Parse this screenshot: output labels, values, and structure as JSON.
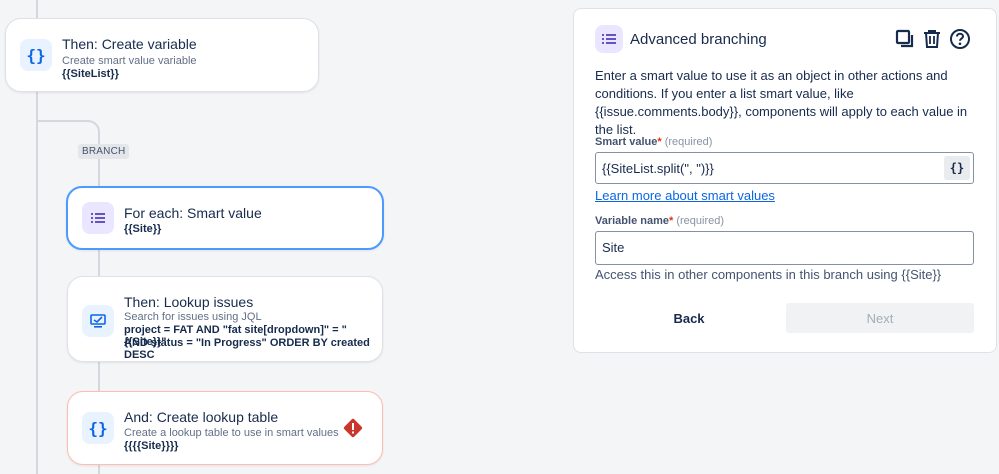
{
  "canvas": {
    "cards": [
      {
        "title": "Then: Create variable",
        "desc": "Create smart value variable",
        "bold": "{{SiteList}}",
        "icon": "braces-icon"
      },
      {
        "title": "For each: Smart value",
        "bold": "{{Site}}",
        "icon": "list-icon"
      },
      {
        "title": "Then: Lookup issues",
        "desc": "Search for issues using JQL",
        "bold_lines": [
          "project = FAT AND \"fat site[dropdown]\" = \"{{Site}}\"",
          "AND status = \"In Progress\" ORDER BY created DESC"
        ],
        "icon": "monitor-icon"
      },
      {
        "title": "And: Create lookup table",
        "desc": "Create a lookup table to use in smart values",
        "bold": "{{{{Site}}}}",
        "icon": "braces-icon",
        "status_icon": "error-diamond-icon"
      }
    ],
    "branch_label": "BRANCH"
  },
  "panel": {
    "title": "Advanced branching",
    "icon": "list-icon",
    "tools": [
      "copy-icon",
      "trash-icon",
      "help-icon"
    ],
    "description": "Enter a smart value to use it as an object in other actions and conditions. If you enter a list smart value, like {{issue.comments.body}}, components will apply to each value in the list.",
    "smart_value": {
      "label": "Smart value",
      "required_mark": "*",
      "required_text": "(required)",
      "value": "{{SiteList.split(\", \")}}",
      "button_label": "{}"
    },
    "learn_more": "Learn more about smart values",
    "variable_name": {
      "label": "Variable name",
      "required_mark": "*",
      "required_text": "(required)",
      "value": "Site"
    },
    "help_text": "Access this in other components in this branch using {{Site}}",
    "back_label": "Back",
    "next_label": "Next"
  },
  "colors": {
    "accent": "#0c66e4",
    "selected_border": "#4c9aff",
    "error": "#de350b"
  }
}
